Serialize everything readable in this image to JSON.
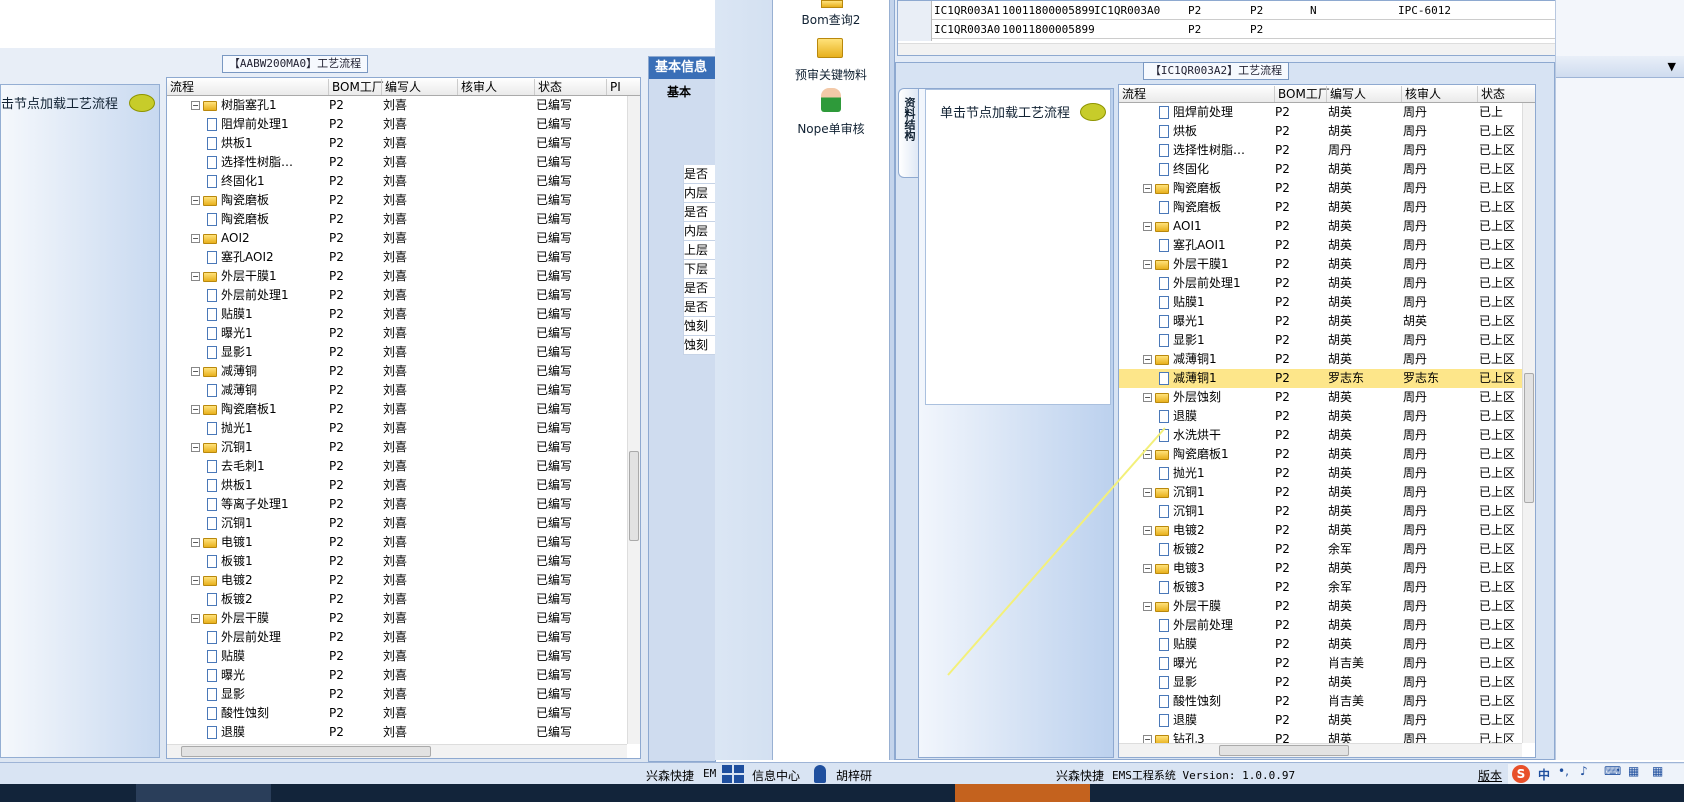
{
  "left_panel": {
    "title": "【AABW200MA0】工艺流程",
    "hint": "击节点加载工艺流程",
    "headers": [
      "流程",
      "BOM工厂",
      "编写人",
      "核审人",
      "状态",
      "PI"
    ],
    "rows": [
      {
        "t": "f",
        "name": "树脂塞孔1",
        "bom": "P2",
        "writer": "刘喜",
        "reviewer": "",
        "status": "已编写"
      },
      {
        "t": "d",
        "name": "阻焊前处理1",
        "bom": "P2",
        "writer": "刘喜",
        "reviewer": "",
        "status": "已编写"
      },
      {
        "t": "d",
        "name": "烘板1",
        "bom": "P2",
        "writer": "刘喜",
        "reviewer": "",
        "status": "已编写"
      },
      {
        "t": "d",
        "name": "选择性树脂…",
        "bom": "P2",
        "writer": "刘喜",
        "reviewer": "",
        "status": "已编写"
      },
      {
        "t": "d",
        "name": "终固化1",
        "bom": "P2",
        "writer": "刘喜",
        "reviewer": "",
        "status": "已编写"
      },
      {
        "t": "f",
        "name": "陶瓷磨板",
        "bom": "P2",
        "writer": "刘喜",
        "reviewer": "",
        "status": "已编写"
      },
      {
        "t": "d",
        "name": "陶瓷磨板",
        "bom": "P2",
        "writer": "刘喜",
        "reviewer": "",
        "status": "已编写"
      },
      {
        "t": "f",
        "name": "AOI2",
        "bom": "P2",
        "writer": "刘喜",
        "reviewer": "",
        "status": "已编写"
      },
      {
        "t": "d",
        "name": "塞孔AOI2",
        "bom": "P2",
        "writer": "刘喜",
        "reviewer": "",
        "status": "已编写"
      },
      {
        "t": "f",
        "name": "外层干膜1",
        "bom": "P2",
        "writer": "刘喜",
        "reviewer": "",
        "status": "已编写"
      },
      {
        "t": "d",
        "name": "外层前处理1",
        "bom": "P2",
        "writer": "刘喜",
        "reviewer": "",
        "status": "已编写"
      },
      {
        "t": "d",
        "name": "贴膜1",
        "bom": "P2",
        "writer": "刘喜",
        "reviewer": "",
        "status": "已编写"
      },
      {
        "t": "d",
        "name": "曝光1",
        "bom": "P2",
        "writer": "刘喜",
        "reviewer": "",
        "status": "已编写"
      },
      {
        "t": "d",
        "name": "显影1",
        "bom": "P2",
        "writer": "刘喜",
        "reviewer": "",
        "status": "已编写"
      },
      {
        "t": "f",
        "name": "减薄铜",
        "bom": "P2",
        "writer": "刘喜",
        "reviewer": "",
        "status": "已编写"
      },
      {
        "t": "d",
        "name": "减薄铜",
        "bom": "P2",
        "writer": "刘喜",
        "reviewer": "",
        "status": "已编写"
      },
      {
        "t": "f",
        "name": "陶瓷磨板1",
        "bom": "P2",
        "writer": "刘喜",
        "reviewer": "",
        "status": "已编写"
      },
      {
        "t": "d",
        "name": "抛光1",
        "bom": "P2",
        "writer": "刘喜",
        "reviewer": "",
        "status": "已编写"
      },
      {
        "t": "f",
        "name": "沉铜1",
        "bom": "P2",
        "writer": "刘喜",
        "reviewer": "",
        "status": "已编写"
      },
      {
        "t": "d",
        "name": "去毛刺1",
        "bom": "P2",
        "writer": "刘喜",
        "reviewer": "",
        "status": "已编写"
      },
      {
        "t": "d",
        "name": "烘板1",
        "bom": "P2",
        "writer": "刘喜",
        "reviewer": "",
        "status": "已编写"
      },
      {
        "t": "d",
        "name": "等离子处理1",
        "bom": "P2",
        "writer": "刘喜",
        "reviewer": "",
        "status": "已编写"
      },
      {
        "t": "d",
        "name": "沉铜1",
        "bom": "P2",
        "writer": "刘喜",
        "reviewer": "",
        "status": "已编写"
      },
      {
        "t": "f",
        "name": "电镀1",
        "bom": "P2",
        "writer": "刘喜",
        "reviewer": "",
        "status": "已编写"
      },
      {
        "t": "d",
        "name": "板镀1",
        "bom": "P2",
        "writer": "刘喜",
        "reviewer": "",
        "status": "已编写"
      },
      {
        "t": "f",
        "name": "电镀2",
        "bom": "P2",
        "writer": "刘喜",
        "reviewer": "",
        "status": "已编写"
      },
      {
        "t": "d",
        "name": "板镀2",
        "bom": "P2",
        "writer": "刘喜",
        "reviewer": "",
        "status": "已编写"
      },
      {
        "t": "f",
        "name": "外层干膜",
        "bom": "P2",
        "writer": "刘喜",
        "reviewer": "",
        "status": "已编写"
      },
      {
        "t": "d",
        "name": "外层前处理",
        "bom": "P2",
        "writer": "刘喜",
        "reviewer": "",
        "status": "已编写"
      },
      {
        "t": "d",
        "name": "贴膜",
        "bom": "P2",
        "writer": "刘喜",
        "reviewer": "",
        "status": "已编写"
      },
      {
        "t": "d",
        "name": "曝光",
        "bom": "P2",
        "writer": "刘喜",
        "reviewer": "",
        "status": "已编写"
      },
      {
        "t": "d",
        "name": "显影",
        "bom": "P2",
        "writer": "刘喜",
        "reviewer": "",
        "status": "已编写"
      },
      {
        "t": "d",
        "name": "酸性蚀刻",
        "bom": "P2",
        "writer": "刘喜",
        "reviewer": "",
        "status": "已编写"
      },
      {
        "t": "d",
        "name": "退膜",
        "bom": "P2",
        "writer": "刘喜",
        "reviewer": "",
        "status": "已编写"
      }
    ]
  },
  "info_panel": {
    "tab": "基本信息",
    "subtab": "基本",
    "rows": [
      "是否",
      "内层",
      "是否",
      "内层",
      "上层",
      "下层",
      "是否",
      "是否",
      "蚀刻",
      "蚀刻"
    ]
  },
  "nav": {
    "items": [
      "Bom查询2",
      "预审关键物料",
      "Nope单审核"
    ]
  },
  "top_grid": {
    "rows": [
      [
        "IC1QR003A1",
        "10011800005899",
        "IC1QR003A0",
        "P2",
        "P2",
        "N",
        "IPC-6012"
      ],
      [
        "IC1QR003A0",
        "10011800005899",
        "",
        "P2",
        "P2",
        "",
        ""
      ]
    ]
  },
  "right_panel": {
    "title": "【IC1QR003A2】工艺流程",
    "side_tab": "资料结构",
    "hint": "单击节点加载工艺流程",
    "headers": [
      "流程",
      "BOM工厂",
      "编写人",
      "核审人",
      "状态"
    ],
    "rows": [
      {
        "t": "d",
        "name": "阻焊前处理",
        "bom": "P2",
        "writer": "胡英",
        "reviewer": "周丹",
        "status": "已上"
      },
      {
        "t": "d",
        "name": "烘板",
        "bom": "P2",
        "writer": "胡英",
        "reviewer": "周丹",
        "status": "已上区"
      },
      {
        "t": "d",
        "name": "选择性树脂…",
        "bom": "P2",
        "writer": "周丹",
        "reviewer": "周丹",
        "status": "已上区"
      },
      {
        "t": "d",
        "name": "终固化",
        "bom": "P2",
        "writer": "胡英",
        "reviewer": "周丹",
        "status": "已上区"
      },
      {
        "t": "f",
        "name": "陶瓷磨板",
        "bom": "P2",
        "writer": "胡英",
        "reviewer": "周丹",
        "status": "已上区"
      },
      {
        "t": "d",
        "name": "陶瓷磨板",
        "bom": "P2",
        "writer": "胡英",
        "reviewer": "周丹",
        "status": "已上区"
      },
      {
        "t": "f",
        "name": "AOI1",
        "bom": "P2",
        "writer": "胡英",
        "reviewer": "周丹",
        "status": "已上区"
      },
      {
        "t": "d",
        "name": "塞孔AOI1",
        "bom": "P2",
        "writer": "胡英",
        "reviewer": "周丹",
        "status": "已上区"
      },
      {
        "t": "f",
        "name": "外层干膜1",
        "bom": "P2",
        "writer": "胡英",
        "reviewer": "周丹",
        "status": "已上区"
      },
      {
        "t": "d",
        "name": "外层前处理1",
        "bom": "P2",
        "writer": "胡英",
        "reviewer": "周丹",
        "status": "已上区"
      },
      {
        "t": "d",
        "name": "贴膜1",
        "bom": "P2",
        "writer": "胡英",
        "reviewer": "周丹",
        "status": "已上区"
      },
      {
        "t": "d",
        "name": "曝光1",
        "bom": "P2",
        "writer": "胡英",
        "reviewer": "胡英",
        "status": "已上区"
      },
      {
        "t": "d",
        "name": "显影1",
        "bom": "P2",
        "writer": "胡英",
        "reviewer": "周丹",
        "status": "已上区"
      },
      {
        "t": "f",
        "name": "减薄铜1",
        "bom": "P2",
        "writer": "胡英",
        "reviewer": "周丹",
        "status": "已上区"
      },
      {
        "t": "d",
        "name": "减薄铜1",
        "bom": "P2",
        "writer": "罗志东",
        "reviewer": "罗志东",
        "status": "已上区",
        "sel": true
      },
      {
        "t": "f",
        "name": "外层蚀刻",
        "bom": "P2",
        "writer": "胡英",
        "reviewer": "周丹",
        "status": "已上区"
      },
      {
        "t": "d",
        "name": "退膜",
        "bom": "P2",
        "writer": "胡英",
        "reviewer": "周丹",
        "status": "已上区"
      },
      {
        "t": "d",
        "name": "水洗烘干",
        "bom": "P2",
        "writer": "胡英",
        "reviewer": "周丹",
        "status": "已上区"
      },
      {
        "t": "f",
        "name": "陶瓷磨板1",
        "bom": "P2",
        "writer": "胡英",
        "reviewer": "周丹",
        "status": "已上区"
      },
      {
        "t": "d",
        "name": "抛光1",
        "bom": "P2",
        "writer": "胡英",
        "reviewer": "周丹",
        "status": "已上区"
      },
      {
        "t": "f",
        "name": "沉铜1",
        "bom": "P2",
        "writer": "胡英",
        "reviewer": "周丹",
        "status": "已上区"
      },
      {
        "t": "d",
        "name": "沉铜1",
        "bom": "P2",
        "writer": "胡英",
        "reviewer": "周丹",
        "status": "已上区"
      },
      {
        "t": "f",
        "name": "电镀2",
        "bom": "P2",
        "writer": "胡英",
        "reviewer": "周丹",
        "status": "已上区"
      },
      {
        "t": "d",
        "name": "板镀2",
        "bom": "P2",
        "writer": "余军",
        "reviewer": "周丹",
        "status": "已上区"
      },
      {
        "t": "f",
        "name": "电镀3",
        "bom": "P2",
        "writer": "胡英",
        "reviewer": "周丹",
        "status": "已上区"
      },
      {
        "t": "d",
        "name": "板镀3",
        "bom": "P2",
        "writer": "余军",
        "reviewer": "周丹",
        "status": "已上区"
      },
      {
        "t": "f",
        "name": "外层干膜",
        "bom": "P2",
        "writer": "胡英",
        "reviewer": "周丹",
        "status": "已上区"
      },
      {
        "t": "d",
        "name": "外层前处理",
        "bom": "P2",
        "writer": "胡英",
        "reviewer": "周丹",
        "status": "已上区"
      },
      {
        "t": "d",
        "name": "贴膜",
        "bom": "P2",
        "writer": "胡英",
        "reviewer": "周丹",
        "status": "已上区"
      },
      {
        "t": "d",
        "name": "曝光",
        "bom": "P2",
        "writer": "肖吉美",
        "reviewer": "周丹",
        "status": "已上区"
      },
      {
        "t": "d",
        "name": "显影",
        "bom": "P2",
        "writer": "胡英",
        "reviewer": "周丹",
        "status": "已上区"
      },
      {
        "t": "d",
        "name": "酸性蚀刻",
        "bom": "P2",
        "writer": "肖吉美",
        "reviewer": "周丹",
        "status": "已上区"
      },
      {
        "t": "d",
        "name": "退膜",
        "bom": "P2",
        "writer": "胡英",
        "reviewer": "周丹",
        "status": "已上区"
      },
      {
        "t": "f",
        "name": "钻孔3",
        "bom": "P2",
        "writer": "胡英",
        "reviewer": "周丹",
        "status": "已上区"
      }
    ]
  },
  "statusbar": {
    "left_text": "兴森快捷",
    "left_suffix": "EM",
    "info_center": "信息中心",
    "user": "胡梓研",
    "system": "兴森快捷",
    "version": "EMS工程系统 Version: 1.0.0.97",
    "right_link": "版本"
  },
  "ime": {
    "label": "中"
  }
}
